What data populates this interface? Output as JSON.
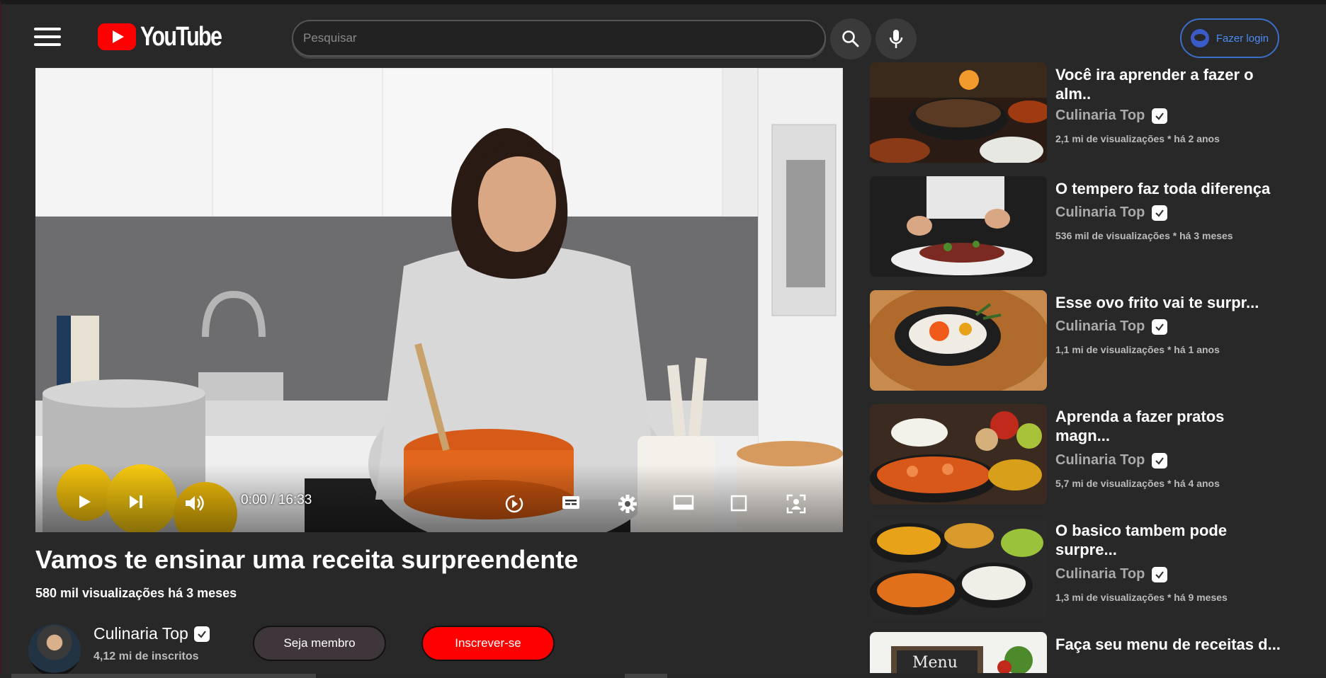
{
  "header": {
    "logo_text": "YouTube",
    "search_placeholder": "Pesquisar",
    "login_label": "Fazer login"
  },
  "player": {
    "time": "0:00 / 16:33"
  },
  "video": {
    "title": "Vamos te ensinar uma receita surpreendente",
    "meta": "580 mil visualizações há 3 meses",
    "channel": "Culinaria Top",
    "subscribers": "4,12 mi de inscritos",
    "member_label": "Seja membro",
    "subscribe_label": "Inscrever-se"
  },
  "recommendations": [
    {
      "title": "Você ira aprender a fazer o alm..",
      "channel": "Culinaria Top",
      "meta": "2,1 mi de visualizações * há 2 anos"
    },
    {
      "title": "O tempero faz toda diferença",
      "channel": "Culinaria Top",
      "meta": "536 mil de visualizações * há 3 meses"
    },
    {
      "title": "Esse ovo frito vai te surpr...",
      "channel": "Culinaria Top",
      "meta": "1,1 mi de visualizações * há 1 anos"
    },
    {
      "title": "Aprenda a fazer pratos magn...",
      "channel": "Culinaria Top",
      "meta": "5,7 mi de visualizações * há 4 anos"
    },
    {
      "title": "O basico tambem pode surpre...",
      "channel": "Culinaria Top",
      "meta": "1,3 mi de visualizações * há 9 meses"
    },
    {
      "title": "Faça seu menu de receitas d...",
      "channel": "",
      "meta": ""
    }
  ],
  "colors": {
    "brand_red": "#ff0000",
    "login_blue": "#4b8cf5",
    "background": "#282828"
  },
  "icons": [
    "menu-icon",
    "youtube-logo-icon",
    "search-icon",
    "mic-icon",
    "user-icon",
    "play-icon",
    "next-icon",
    "volume-icon",
    "autoplay-icon",
    "subtitles-icon",
    "settings-icon",
    "miniplayer-icon",
    "theater-icon",
    "fullscreen-icon",
    "verified-icon"
  ]
}
